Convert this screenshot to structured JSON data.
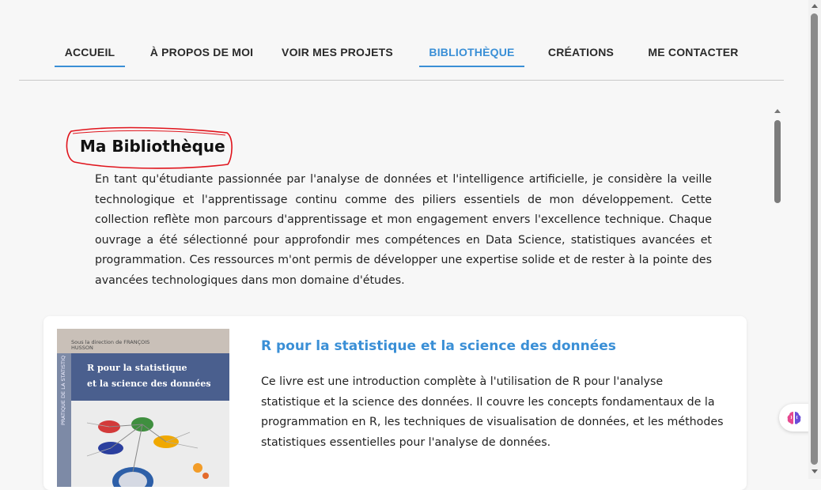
{
  "nav": {
    "items": [
      {
        "label": "ACCUEIL"
      },
      {
        "label": "À PROPOS DE MOI"
      },
      {
        "label": "VOIR MES PROJETS"
      },
      {
        "label": "BIBLIOTHÈQUE"
      },
      {
        "label": "CRÉATIONS"
      },
      {
        "label": "ME CONTACTER"
      }
    ],
    "active_color": "#3a8fd6"
  },
  "page": {
    "title": "Ma Bibliothèque",
    "intro": "En tant qu'étudiante passionnée par l'analyse de données et l'intelligence artificielle, je considère la veille technologique et l'apprentissage continu comme des piliers essentiels de mon développement. Cette collection reflète mon parcours d'apprentissage et mon engagement envers l'excellence technique. Chaque ouvrage a été sélectionné pour approfondir mes compétences en Data Science, statistiques avancées et programmation. Ces ressources m'ont permis de développer une expertise solide et de rester à la pointe des avancées technologiques dans mon domaine d'études."
  },
  "books": [
    {
      "title": "R pour la statistique et la science des données",
      "description": "Ce livre est une introduction complète à l'utilisation de R pour l'analyse statistique et la science des données. Il couvre les concepts fondamentaux de la programmation en R, les techniques de visualisation de données, et les méthodes statistiques essentielles pour l'analyse de données.",
      "cover": {
        "top_text": "Sous la direction de FRANÇOIS HUSSON",
        "side_text": "PRATIQUE DE LA STATISTIQUE",
        "title_line1": "R pour la statistique",
        "title_line2": "et la science des données"
      }
    }
  ],
  "widgets": {
    "brain_icon": "brain-icon"
  },
  "colors": {
    "accent": "#3a8fd6",
    "highlight_circle": "#e0141c"
  }
}
